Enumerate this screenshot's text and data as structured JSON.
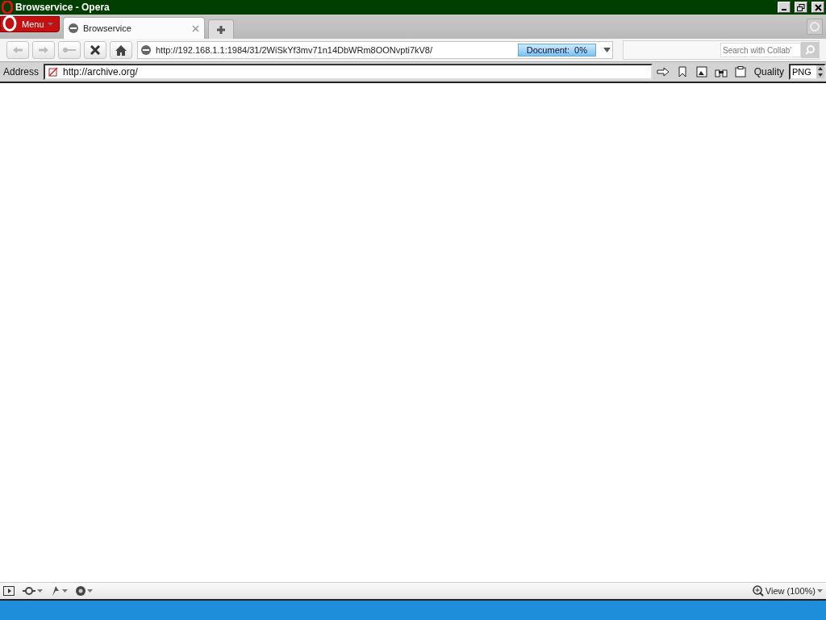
{
  "window": {
    "title": "Browservice - Opera"
  },
  "menu_button": {
    "label": "Menu"
  },
  "tabs": [
    {
      "label": "Browservice",
      "selected": true
    }
  ],
  "url_field": {
    "value": "http://192.168.1.1:1984/31/2WiSkYf3mv71n14DbWRm8OONvpti7kV8/",
    "progress": "Document:  0%"
  },
  "search_field": {
    "placeholder": "Search with Collab'"
  },
  "address_bar": {
    "label": "Address",
    "value": "http://archive.org/",
    "quality_label": "Quality",
    "quality_value": "PNG"
  },
  "status_bar": {
    "zoom": "View (100%)"
  }
}
